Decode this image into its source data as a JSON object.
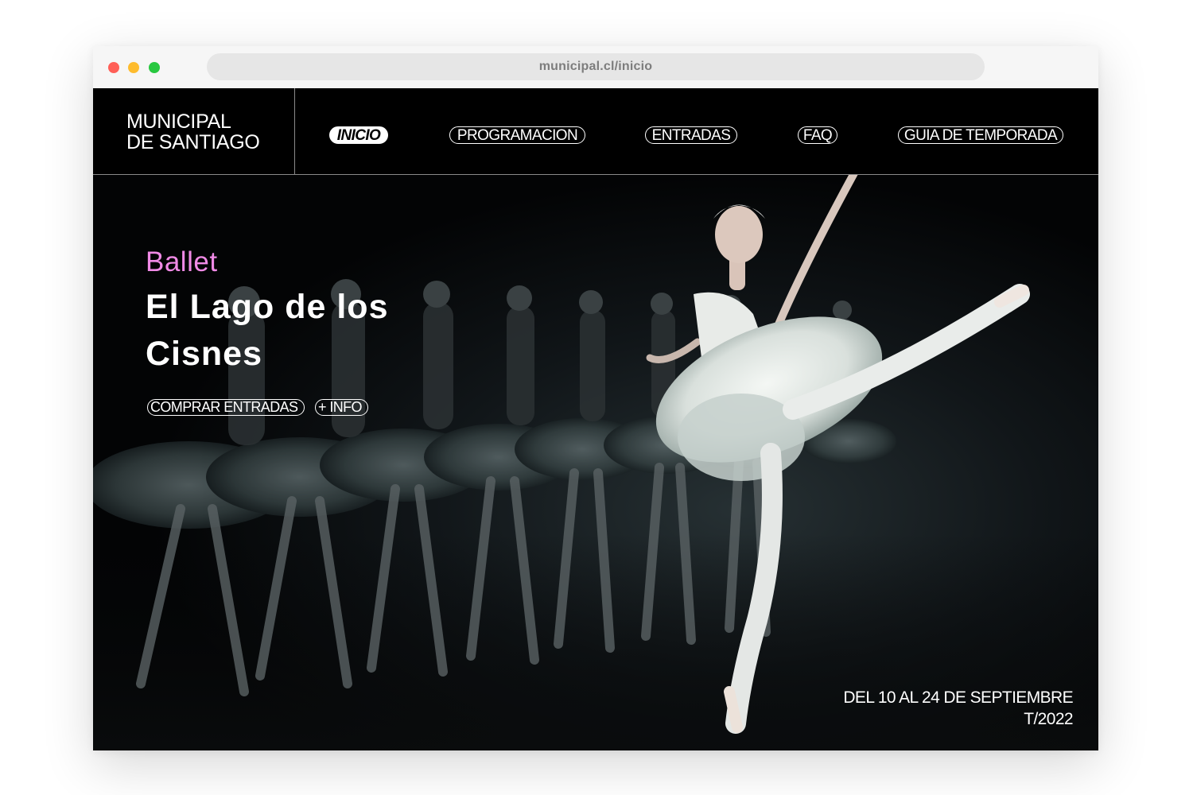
{
  "browser": {
    "url": "municipal.cl/inicio",
    "traffic_lights": {
      "close": "#ff5f57",
      "minimize": "#febc2e",
      "maximize": "#28c840"
    }
  },
  "brand": {
    "line1": "MUNICIPAL",
    "line2": "DE SANTIAGO"
  },
  "nav": {
    "items": [
      {
        "label": "INICIO",
        "active": true
      },
      {
        "label": "PROGRAMACION",
        "active": false
      },
      {
        "label": "ENTRADAS",
        "active": false
      },
      {
        "label": "FAQ",
        "active": false
      },
      {
        "label": "GUIA DE TEMPORADA",
        "active": false
      }
    ]
  },
  "hero": {
    "category": "Ballet",
    "title": "El Lago de los Cisnes",
    "buy_label": "COMPRAR ENTRADAS",
    "info_label": "+ INFO",
    "dates": "DEL 10 AL 24 DE SEPTIEMBRE",
    "season": "T/2022",
    "image": "ballet-swan-lake-photo"
  },
  "colors": {
    "accent": "#f08ae6",
    "background": "#000000",
    "text": "#ffffff"
  }
}
